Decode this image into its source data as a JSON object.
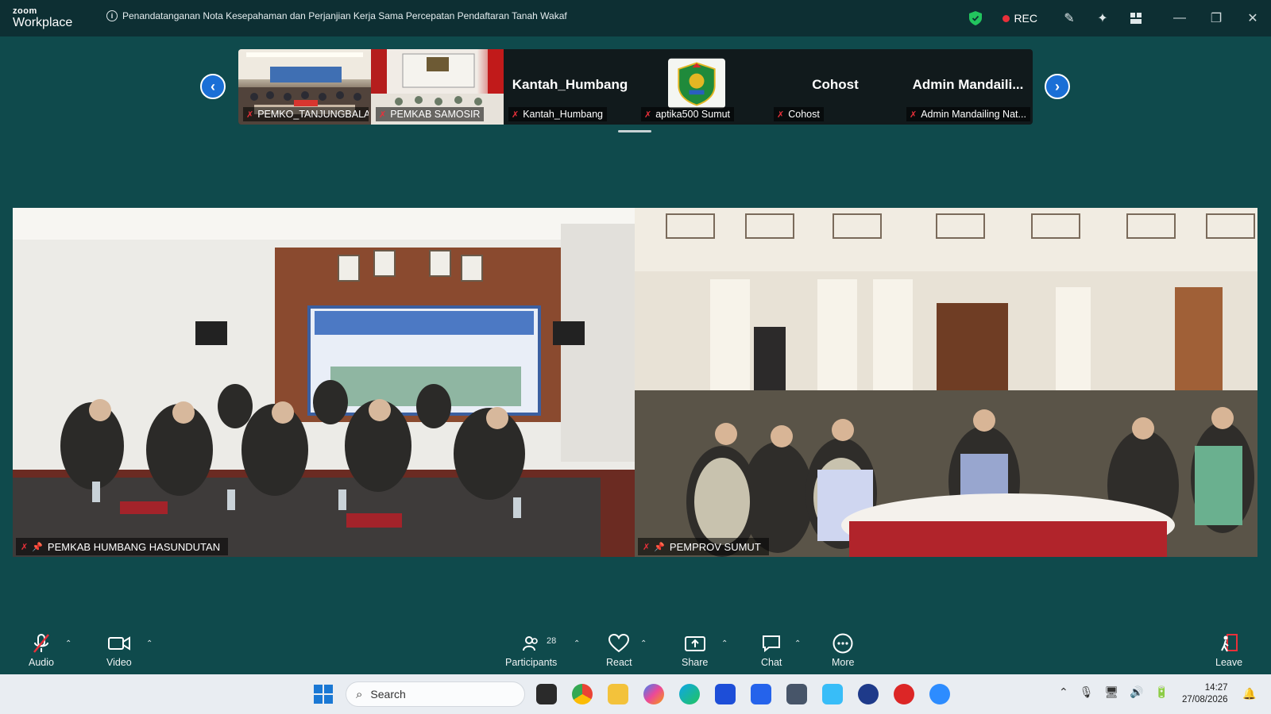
{
  "app": {
    "brand_small": "zoom",
    "brand_name": "Workplace"
  },
  "meeting": {
    "title": "Penandatanganan Nota Kesepahaman dan Perjanjian Kerja Sama Percepatan Pendaftaran Tanah Wakaf",
    "rec_label": "REC"
  },
  "gallery": {
    "tiles": [
      {
        "label": "PEMKO_TANJUNGBALAI",
        "name_display": ""
      },
      {
        "label": "PEMKAB SAMOSIR",
        "name_display": ""
      },
      {
        "label": "Kantah_Humbang",
        "name_display": "Kantah_Humbang"
      },
      {
        "label": "aptika500 Sumut",
        "name_display": ""
      },
      {
        "label": "Cohost",
        "name_display": "Cohost"
      },
      {
        "label": "Admin Mandailing Nat...",
        "name_display": "Admin  Mandaili..."
      }
    ]
  },
  "videos": {
    "left_label": "PEMKAB HUMBANG HASUNDUTAN",
    "right_label": "PEMPROV SUMUT"
  },
  "toolbar": {
    "audio": "Audio",
    "video": "Video",
    "participants": "Participants",
    "participant_count": "28",
    "react": "React",
    "share": "Share",
    "chat": "Chat",
    "more": "More",
    "leave": "Leave"
  },
  "taskbar": {
    "search_placeholder": "Search",
    "time": "14:27",
    "date": "27/08/2026"
  },
  "colors": {
    "accent": "#1a6fd6",
    "rec": "#e9303a",
    "background": "#0f4a4c"
  }
}
